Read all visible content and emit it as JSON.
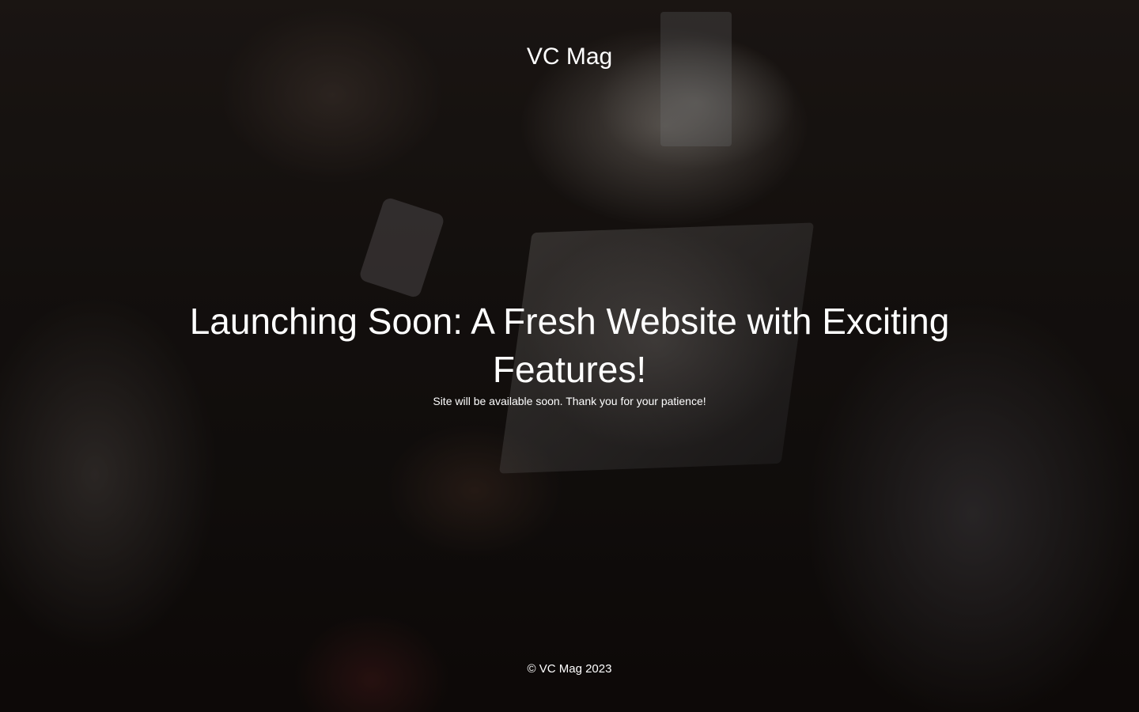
{
  "site": {
    "title": "VC Mag"
  },
  "main": {
    "headline": "Launching Soon: A Fresh Website with Exciting Features!",
    "subtext": "Site will be available soon. Thank you for your patience!"
  },
  "footer": {
    "copyright": "© VC Mag 2023"
  },
  "colors": {
    "text": "#ffffff",
    "overlay": "rgba(0,0,0,0.38)"
  }
}
